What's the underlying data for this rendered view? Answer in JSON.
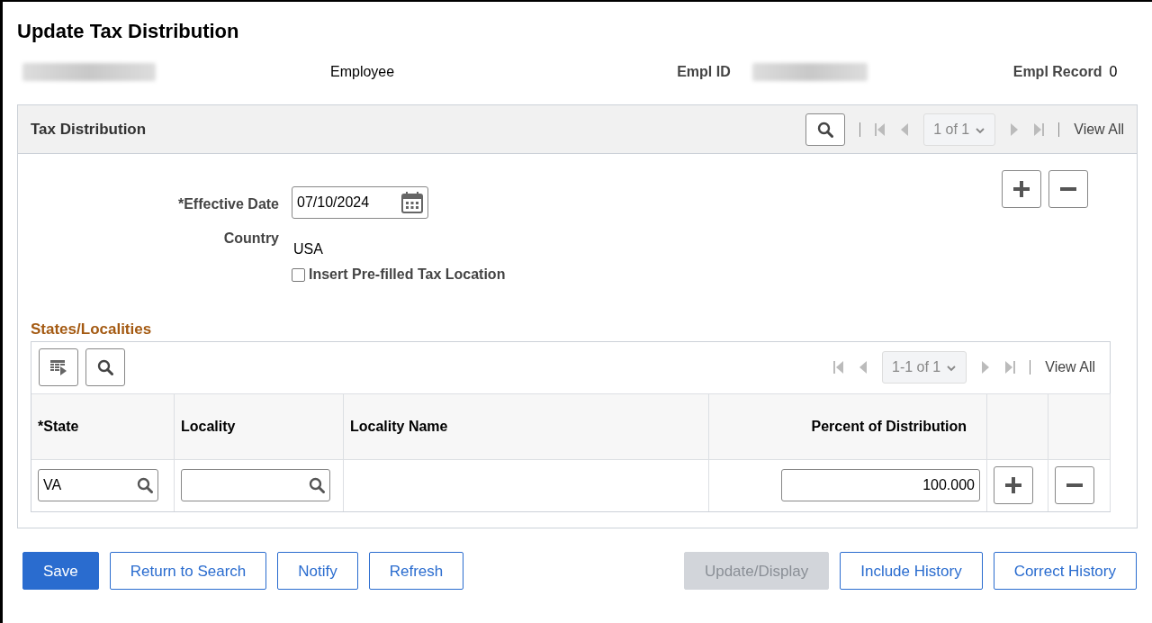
{
  "title": "Update Tax Distribution",
  "header": {
    "employee_label": "Employee",
    "empl_id_label": "Empl ID",
    "empl_record_label": "Empl Record",
    "empl_record_value": "0"
  },
  "panel": {
    "title": "Tax Distribution",
    "pager": {
      "count": "1 of 1",
      "view_all": "View All"
    },
    "effective_date": {
      "label": "*Effective Date",
      "value": "07/10/2024"
    },
    "country": {
      "label": "Country",
      "value": "USA"
    },
    "prefill_checkbox": {
      "label": "Insert Pre-filled Tax Location",
      "checked": false
    },
    "grid": {
      "title": "States/Localities",
      "pager": {
        "count": "1-1 of 1",
        "view_all": "View All"
      },
      "columns": [
        "*State",
        "Locality",
        "Locality Name",
        "Percent of Distribution"
      ],
      "rows": [
        {
          "state": "VA",
          "locality": "",
          "percent": "100.000"
        }
      ]
    }
  },
  "buttons": [
    {
      "label": "Save",
      "kind": "primary",
      "disabled": false
    },
    {
      "label": "Return to Search",
      "kind": "secondary",
      "disabled": false
    },
    {
      "label": "Notify",
      "kind": "secondary",
      "disabled": false
    },
    {
      "label": "Refresh",
      "kind": "secondary",
      "disabled": false
    },
    {
      "label": "Update/Display",
      "kind": "secondary",
      "disabled": true
    },
    {
      "label": "Include History",
      "kind": "secondary",
      "disabled": false
    },
    {
      "label": "Correct History",
      "kind": "secondary",
      "disabled": false
    }
  ]
}
